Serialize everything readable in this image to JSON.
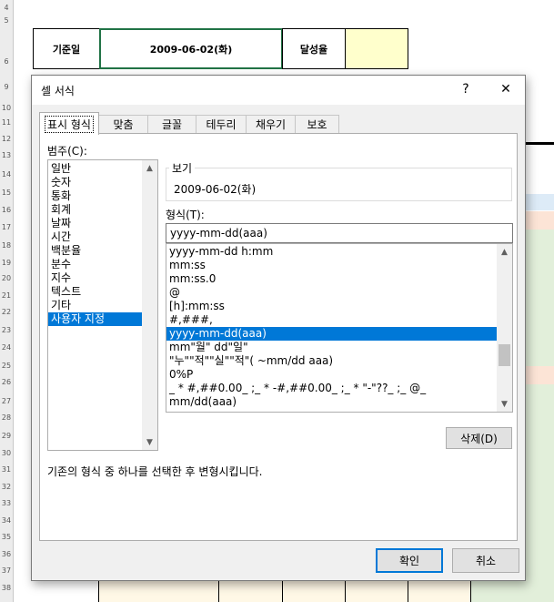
{
  "sheet": {
    "row_numbers": [
      "4",
      "5",
      "6",
      "9",
      "10",
      "11",
      "12",
      "13",
      "14",
      "15",
      "16",
      "17",
      "18",
      "19",
      "20",
      "21",
      "22",
      "23",
      "24",
      "25",
      "26",
      "27",
      "28",
      "29",
      "30",
      "31",
      "32",
      "33",
      "34",
      "35",
      "36",
      "37",
      "38"
    ],
    "cell_a_label": "기준일",
    "cell_b_value": "2009-06-02(화)",
    "cell_c_label": "달성율"
  },
  "dialog": {
    "title": "셀 서식",
    "help_label": "?",
    "close_label": "✕",
    "tabs": [
      {
        "label": "표시 형식",
        "active": true
      },
      {
        "label": "맞춤",
        "active": false
      },
      {
        "label": "글꼴",
        "active": false
      },
      {
        "label": "테두리",
        "active": false
      },
      {
        "label": "채우기",
        "active": false
      },
      {
        "label": "보호",
        "active": false
      }
    ],
    "category_label": "범주(C):",
    "categories": [
      {
        "label": "일반",
        "selected": false
      },
      {
        "label": "숫자",
        "selected": false
      },
      {
        "label": "통화",
        "selected": false
      },
      {
        "label": "회계",
        "selected": false
      },
      {
        "label": "날짜",
        "selected": false
      },
      {
        "label": "시간",
        "selected": false
      },
      {
        "label": "백분율",
        "selected": false
      },
      {
        "label": "분수",
        "selected": false
      },
      {
        "label": "지수",
        "selected": false
      },
      {
        "label": "텍스트",
        "selected": false
      },
      {
        "label": "기타",
        "selected": false
      },
      {
        "label": "사용자 지정",
        "selected": true
      }
    ],
    "preview_label": "보기",
    "preview_value": "2009-06-02(화)",
    "format_label": "형식(T):",
    "format_value": "yyyy-mm-dd(aaa)",
    "formats": [
      {
        "label": "yyyy-mm-dd h:mm",
        "selected": false
      },
      {
        "label": "mm:ss",
        "selected": false
      },
      {
        "label": "mm:ss.0",
        "selected": false
      },
      {
        "label": "@",
        "selected": false
      },
      {
        "label": "[h]:mm:ss",
        "selected": false
      },
      {
        "label": "#,###,",
        "selected": false
      },
      {
        "label": "yyyy-mm-dd(aaa)",
        "selected": true
      },
      {
        "label": "mm\"월\" dd\"일\"",
        "selected": false
      },
      {
        "label": "\"누\"\"적\"\"실\"\"적\"( ~mm/dd aaa)",
        "selected": false
      },
      {
        "label": "0%P",
        "selected": false
      },
      {
        "label": "_ * #,##0.00_ ;_ * -#,##0.00_ ;_ * \"-\"??_ ;_ @_",
        "selected": false
      },
      {
        "label": "mm/dd(aaa)",
        "selected": false
      }
    ],
    "delete_label": "삭제(D)",
    "description": "기존의 형식 중 하나를 선택한 후 변형시킵니다.",
    "ok_label": "확인",
    "cancel_label": "취소"
  },
  "colors": {
    "selection": "#0078d7",
    "cell_border_active": "#217346",
    "yellow_fill": "#ffffcc",
    "green_fill": "#e2efda",
    "peach_fill": "#fce4d6",
    "blue_fill": "#ddebf7"
  }
}
